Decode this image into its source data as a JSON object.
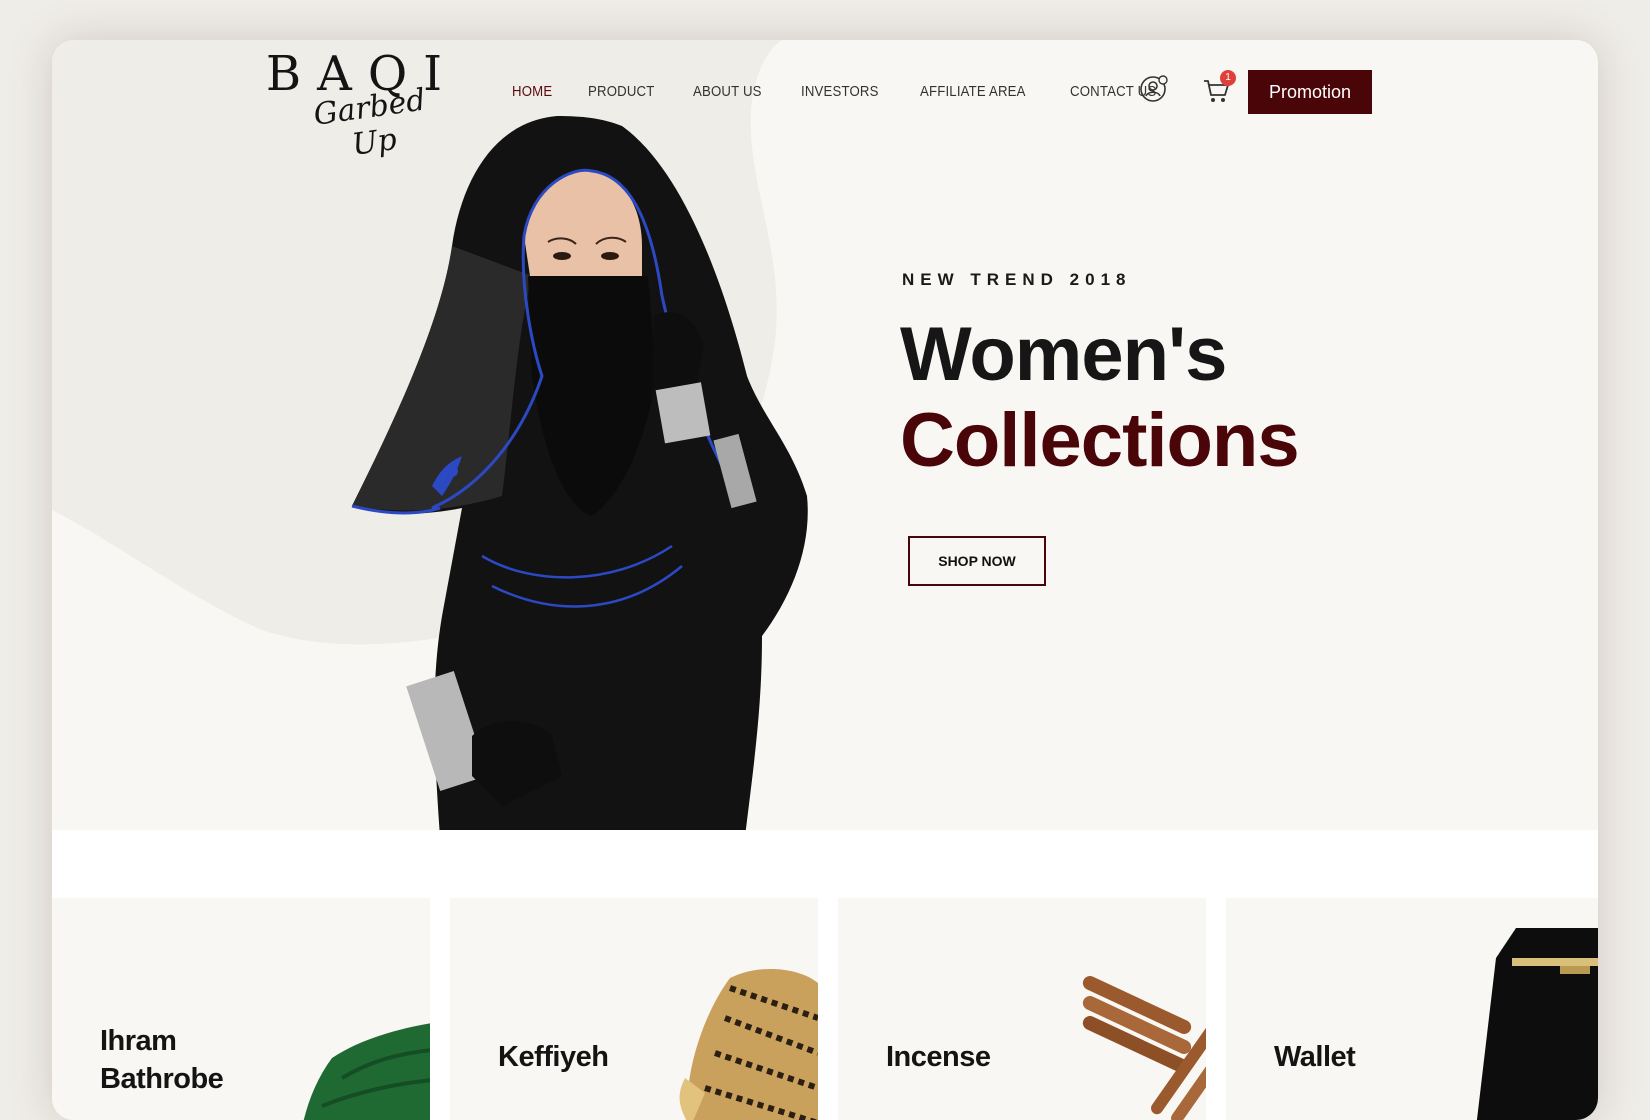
{
  "brand": {
    "name": "BAQI",
    "tagline": "Garbed Up"
  },
  "nav": {
    "items": [
      {
        "label": "HOME",
        "active": true
      },
      {
        "label": "PRODUCT"
      },
      {
        "label": "ABOUT US"
      },
      {
        "label": "INVESTORS"
      },
      {
        "label": "AFFILIATE AREA"
      },
      {
        "label": "CONTACT US"
      }
    ]
  },
  "header": {
    "cart_count": "1",
    "promo_label": "Promotion",
    "user_icon": "user-account-icon",
    "cart_icon": "shopping-cart-icon"
  },
  "hero": {
    "eyebrow": "NEW TREND 2018",
    "title_line1": "Women's",
    "title_line2": "Collections",
    "cta": "SHOP NOW"
  },
  "categories": [
    {
      "title_line1": "Ihram",
      "title_line2": "Bathrobe"
    },
    {
      "title_line1": "Keffiyeh"
    },
    {
      "title_line1": "Incense"
    },
    {
      "title_line1": "Wallet"
    }
  ],
  "colors": {
    "accent": "#4a0508",
    "background": "#f8f7f3",
    "badge": "#e0403a"
  }
}
